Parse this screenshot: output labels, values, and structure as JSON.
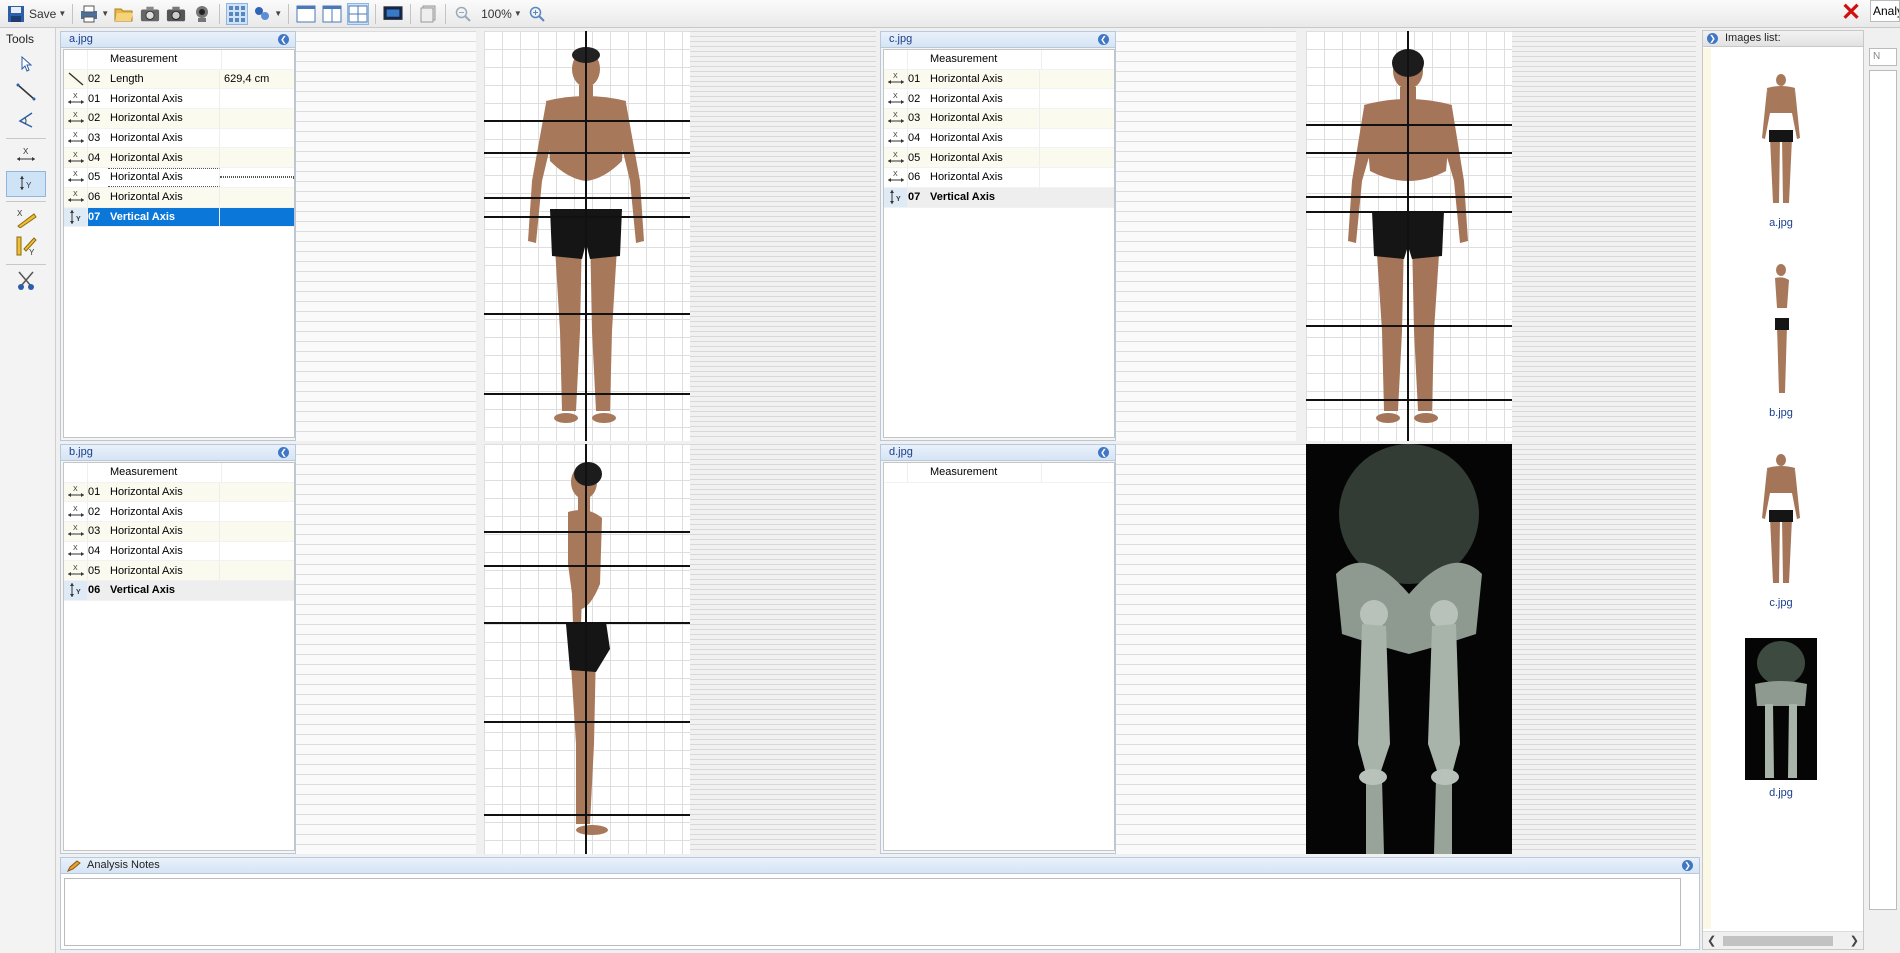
{
  "toolbar": {
    "save_label": "Save",
    "zoom_value": "100%"
  },
  "right_tab_label": "Analy",
  "right_select_value": "N",
  "tools_title": "Tools",
  "panels": [
    {
      "title": "a.jpg",
      "header": "Measurement",
      "rows": [
        {
          "icon": "length-icon",
          "num": "02",
          "name": "Length",
          "value": "629,4 cm"
        },
        {
          "icon": "horizontal-axis-icon",
          "num": "01",
          "name": "Horizontal Axis",
          "value": ""
        },
        {
          "icon": "horizontal-axis-icon",
          "num": "02",
          "name": "Horizontal Axis",
          "value": ""
        },
        {
          "icon": "horizontal-axis-icon",
          "num": "03",
          "name": "Horizontal Axis",
          "value": ""
        },
        {
          "icon": "horizontal-axis-icon",
          "num": "04",
          "name": "Horizontal Axis",
          "value": ""
        },
        {
          "icon": "horizontal-axis-icon",
          "num": "05",
          "name": "Horizontal Axis",
          "value": ""
        },
        {
          "icon": "horizontal-axis-icon",
          "num": "06",
          "name": "Horizontal Axis",
          "value": ""
        },
        {
          "icon": "vertical-axis-icon",
          "num": "07",
          "name": "Vertical Axis",
          "value": ""
        }
      ]
    },
    {
      "title": "c.jpg",
      "header": "Measurement",
      "rows": [
        {
          "icon": "horizontal-axis-icon",
          "num": "01",
          "name": "Horizontal Axis",
          "value": ""
        },
        {
          "icon": "horizontal-axis-icon",
          "num": "02",
          "name": "Horizontal Axis",
          "value": ""
        },
        {
          "icon": "horizontal-axis-icon",
          "num": "03",
          "name": "Horizontal Axis",
          "value": ""
        },
        {
          "icon": "horizontal-axis-icon",
          "num": "04",
          "name": "Horizontal Axis",
          "value": ""
        },
        {
          "icon": "horizontal-axis-icon",
          "num": "05",
          "name": "Horizontal Axis",
          "value": ""
        },
        {
          "icon": "horizontal-axis-icon",
          "num": "06",
          "name": "Horizontal Axis",
          "value": ""
        },
        {
          "icon": "vertical-axis-icon",
          "num": "07",
          "name": "Vertical Axis",
          "value": ""
        }
      ]
    },
    {
      "title": "b.jpg",
      "header": "Measurement",
      "rows": [
        {
          "icon": "horizontal-axis-icon",
          "num": "01",
          "name": "Horizontal Axis",
          "value": ""
        },
        {
          "icon": "horizontal-axis-icon",
          "num": "02",
          "name": "Horizontal Axis",
          "value": ""
        },
        {
          "icon": "horizontal-axis-icon",
          "num": "03",
          "name": "Horizontal Axis",
          "value": ""
        },
        {
          "icon": "horizontal-axis-icon",
          "num": "04",
          "name": "Horizontal Axis",
          "value": ""
        },
        {
          "icon": "horizontal-axis-icon",
          "num": "05",
          "name": "Horizontal Axis",
          "value": ""
        },
        {
          "icon": "vertical-axis-icon",
          "num": "06",
          "name": "Vertical Axis",
          "value": ""
        }
      ]
    },
    {
      "title": "d.jpg",
      "header": "Measurement",
      "rows": []
    }
  ],
  "images_list": {
    "title": "Images list:",
    "items": [
      {
        "caption": "a.jpg"
      },
      {
        "caption": "b.jpg"
      },
      {
        "caption": "c.jpg"
      },
      {
        "caption": "d.jpg"
      }
    ]
  },
  "notes": {
    "title": "Analysis Notes",
    "content": ""
  }
}
